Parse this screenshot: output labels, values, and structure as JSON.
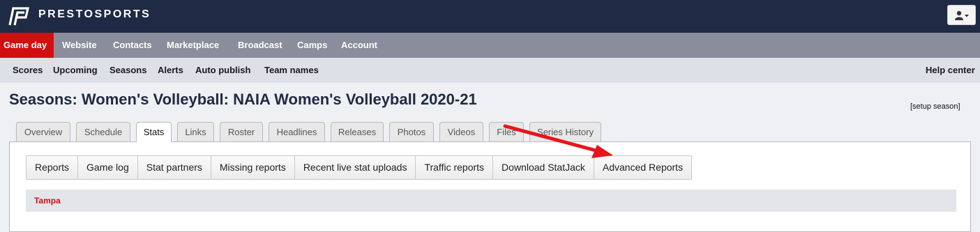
{
  "brand": {
    "name": "PRESTOSPORTS",
    "logo": "prestosports-logo"
  },
  "main_nav": {
    "items": [
      {
        "label": "Game day",
        "active": true
      },
      {
        "label": "Website"
      },
      {
        "label": "Contacts"
      },
      {
        "label": "Marketplace"
      },
      {
        "label": "Broadcast"
      },
      {
        "label": "Camps"
      },
      {
        "label": "Account"
      }
    ]
  },
  "sub_nav": {
    "items": [
      {
        "label": "Scores"
      },
      {
        "label": "Upcoming"
      },
      {
        "label": "Seasons"
      },
      {
        "label": "Alerts"
      },
      {
        "label": "Auto publish"
      },
      {
        "label": "Team names"
      }
    ],
    "help": "Help center"
  },
  "page": {
    "title": "Seasons: Women's Volleyball: NAIA Women's Volleyball 2020-21",
    "setup_link": "[setup season]"
  },
  "tabs": [
    {
      "label": "Overview"
    },
    {
      "label": "Schedule"
    },
    {
      "label": "Stats",
      "active": true
    },
    {
      "label": "Links"
    },
    {
      "label": "Roster"
    },
    {
      "label": "Headlines"
    },
    {
      "label": "Releases"
    },
    {
      "label": "Photos"
    },
    {
      "label": "Videos"
    },
    {
      "label": "Files"
    },
    {
      "label": "Series History"
    }
  ],
  "stats_tabs": [
    {
      "label": "Reports"
    },
    {
      "label": "Game log"
    },
    {
      "label": "Stat partners"
    },
    {
      "label": "Missing reports"
    },
    {
      "label": "Recent live stat uploads"
    },
    {
      "label": "Traffic reports"
    },
    {
      "label": "Download StatJack"
    },
    {
      "label": "Advanced Reports"
    }
  ],
  "section": {
    "title": "Tampa"
  },
  "colors": {
    "topbar": "#1f2a44",
    "main_nav": "#8a8e9c",
    "active_nav": "#d20f10",
    "sub_nav": "#dde0e7",
    "arrow": "#e8141b",
    "section_title": "#cc1111"
  },
  "icons": {
    "user_menu": "user-icon",
    "user_caret": "caret-down-icon"
  }
}
